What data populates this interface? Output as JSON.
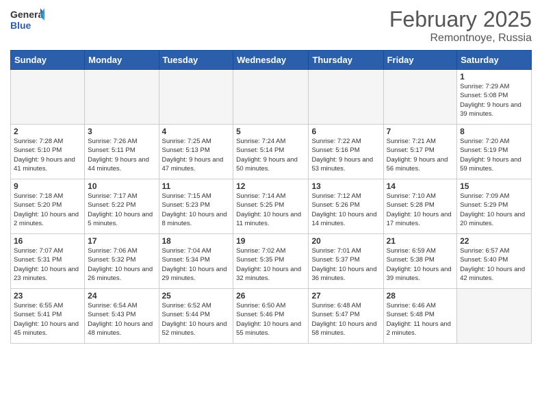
{
  "header": {
    "logo_text_general": "General",
    "logo_text_blue": "Blue",
    "month_title": "February 2025",
    "location": "Remontnoye, Russia"
  },
  "calendar": {
    "days_of_week": [
      "Sunday",
      "Monday",
      "Tuesday",
      "Wednesday",
      "Thursday",
      "Friday",
      "Saturday"
    ],
    "weeks": [
      [
        {
          "day": "",
          "info": ""
        },
        {
          "day": "",
          "info": ""
        },
        {
          "day": "",
          "info": ""
        },
        {
          "day": "",
          "info": ""
        },
        {
          "day": "",
          "info": ""
        },
        {
          "day": "",
          "info": ""
        },
        {
          "day": "1",
          "info": "Sunrise: 7:29 AM\nSunset: 5:08 PM\nDaylight: 9 hours and 39 minutes."
        }
      ],
      [
        {
          "day": "2",
          "info": "Sunrise: 7:28 AM\nSunset: 5:10 PM\nDaylight: 9 hours and 41 minutes."
        },
        {
          "day": "3",
          "info": "Sunrise: 7:26 AM\nSunset: 5:11 PM\nDaylight: 9 hours and 44 minutes."
        },
        {
          "day": "4",
          "info": "Sunrise: 7:25 AM\nSunset: 5:13 PM\nDaylight: 9 hours and 47 minutes."
        },
        {
          "day": "5",
          "info": "Sunrise: 7:24 AM\nSunset: 5:14 PM\nDaylight: 9 hours and 50 minutes."
        },
        {
          "day": "6",
          "info": "Sunrise: 7:22 AM\nSunset: 5:16 PM\nDaylight: 9 hours and 53 minutes."
        },
        {
          "day": "7",
          "info": "Sunrise: 7:21 AM\nSunset: 5:17 PM\nDaylight: 9 hours and 56 minutes."
        },
        {
          "day": "8",
          "info": "Sunrise: 7:20 AM\nSunset: 5:19 PM\nDaylight: 9 hours and 59 minutes."
        }
      ],
      [
        {
          "day": "9",
          "info": "Sunrise: 7:18 AM\nSunset: 5:20 PM\nDaylight: 10 hours and 2 minutes."
        },
        {
          "day": "10",
          "info": "Sunrise: 7:17 AM\nSunset: 5:22 PM\nDaylight: 10 hours and 5 minutes."
        },
        {
          "day": "11",
          "info": "Sunrise: 7:15 AM\nSunset: 5:23 PM\nDaylight: 10 hours and 8 minutes."
        },
        {
          "day": "12",
          "info": "Sunrise: 7:14 AM\nSunset: 5:25 PM\nDaylight: 10 hours and 11 minutes."
        },
        {
          "day": "13",
          "info": "Sunrise: 7:12 AM\nSunset: 5:26 PM\nDaylight: 10 hours and 14 minutes."
        },
        {
          "day": "14",
          "info": "Sunrise: 7:10 AM\nSunset: 5:28 PM\nDaylight: 10 hours and 17 minutes."
        },
        {
          "day": "15",
          "info": "Sunrise: 7:09 AM\nSunset: 5:29 PM\nDaylight: 10 hours and 20 minutes."
        }
      ],
      [
        {
          "day": "16",
          "info": "Sunrise: 7:07 AM\nSunset: 5:31 PM\nDaylight: 10 hours and 23 minutes."
        },
        {
          "day": "17",
          "info": "Sunrise: 7:06 AM\nSunset: 5:32 PM\nDaylight: 10 hours and 26 minutes."
        },
        {
          "day": "18",
          "info": "Sunrise: 7:04 AM\nSunset: 5:34 PM\nDaylight: 10 hours and 29 minutes."
        },
        {
          "day": "19",
          "info": "Sunrise: 7:02 AM\nSunset: 5:35 PM\nDaylight: 10 hours and 32 minutes."
        },
        {
          "day": "20",
          "info": "Sunrise: 7:01 AM\nSunset: 5:37 PM\nDaylight: 10 hours and 36 minutes."
        },
        {
          "day": "21",
          "info": "Sunrise: 6:59 AM\nSunset: 5:38 PM\nDaylight: 10 hours and 39 minutes."
        },
        {
          "day": "22",
          "info": "Sunrise: 6:57 AM\nSunset: 5:40 PM\nDaylight: 10 hours and 42 minutes."
        }
      ],
      [
        {
          "day": "23",
          "info": "Sunrise: 6:55 AM\nSunset: 5:41 PM\nDaylight: 10 hours and 45 minutes."
        },
        {
          "day": "24",
          "info": "Sunrise: 6:54 AM\nSunset: 5:43 PM\nDaylight: 10 hours and 48 minutes."
        },
        {
          "day": "25",
          "info": "Sunrise: 6:52 AM\nSunset: 5:44 PM\nDaylight: 10 hours and 52 minutes."
        },
        {
          "day": "26",
          "info": "Sunrise: 6:50 AM\nSunset: 5:46 PM\nDaylight: 10 hours and 55 minutes."
        },
        {
          "day": "27",
          "info": "Sunrise: 6:48 AM\nSunset: 5:47 PM\nDaylight: 10 hours and 58 minutes."
        },
        {
          "day": "28",
          "info": "Sunrise: 6:46 AM\nSunset: 5:48 PM\nDaylight: 11 hours and 2 minutes."
        },
        {
          "day": "",
          "info": ""
        }
      ]
    ]
  }
}
